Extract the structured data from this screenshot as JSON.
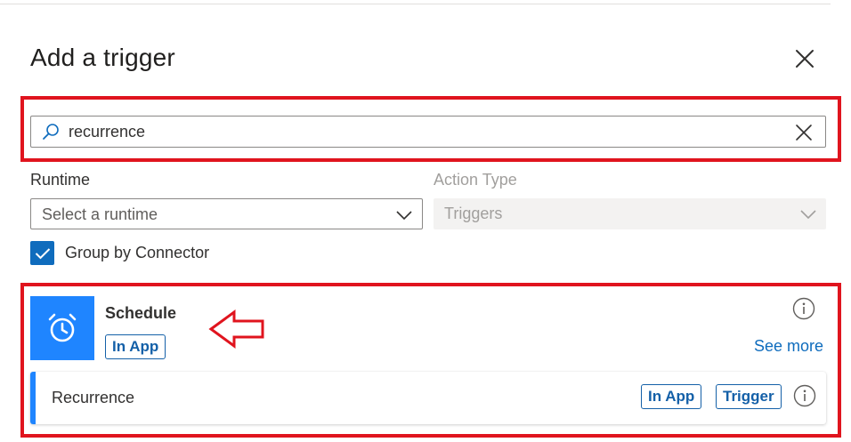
{
  "panel": {
    "title": "Add a trigger"
  },
  "search": {
    "value": "recurrence"
  },
  "filters": {
    "runtime_label": "Runtime",
    "runtime_value": "Select a runtime",
    "action_type_label": "Action Type",
    "action_type_value": "Triggers",
    "group_by_connector_label": "Group by Connector",
    "group_by_connector_checked": true
  },
  "results": {
    "connector": {
      "name": "Schedule",
      "badge": "In App",
      "see_more": "See more",
      "icon": "alarm-clock-icon",
      "tile_color": "#1f85ff"
    },
    "operations": [
      {
        "name": "Recurrence",
        "badges": [
          "In App",
          "Trigger"
        ]
      }
    ]
  },
  "colors": {
    "highlight": "#e0141e",
    "accent": "#0f6cbd",
    "badge": "#1460a8"
  }
}
